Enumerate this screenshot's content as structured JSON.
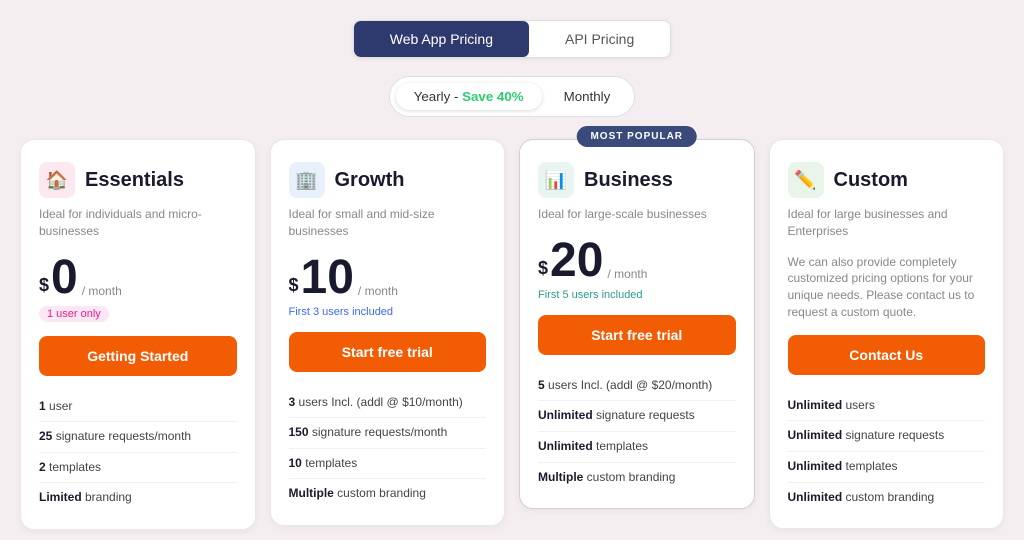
{
  "tabs": {
    "items": [
      {
        "id": "web-app",
        "label": "Web App Pricing",
        "active": true
      },
      {
        "id": "api",
        "label": "API Pricing",
        "active": false
      }
    ]
  },
  "billing": {
    "options": [
      {
        "id": "yearly",
        "label": "Yearly - ",
        "save": "Save 40%",
        "active": true
      },
      {
        "id": "monthly",
        "label": "Monthly",
        "active": false
      }
    ]
  },
  "cards": [
    {
      "id": "essentials",
      "title": "Essentials",
      "icon": "🏠",
      "icon_class": "icon-essentials",
      "subtitle": "Ideal for individuals and micro-businesses",
      "price": "0",
      "period": "/ month",
      "note": "1 user only",
      "note_class": "note-pink",
      "cta": "Getting Started",
      "popular": false,
      "features": [
        {
          "bold": "1",
          "rest": " user"
        },
        {
          "bold": "25",
          "rest": " signature requests/month"
        },
        {
          "bold": "2",
          "rest": " templates"
        },
        {
          "bold": "Limited",
          "rest": " branding"
        }
      ]
    },
    {
      "id": "growth",
      "title": "Growth",
      "icon": "🏢",
      "icon_class": "icon-growth",
      "subtitle": "Ideal for small and mid-size businesses",
      "price": "10",
      "period": "/ month",
      "note": "First 3 users included",
      "note_class": "note-blue",
      "cta": "Start free trial",
      "popular": false,
      "features": [
        {
          "bold": "3",
          "rest": " users Incl. (addl @ $10/month)"
        },
        {
          "bold": "150",
          "rest": " signature requests/month"
        },
        {
          "bold": "10",
          "rest": " templates"
        },
        {
          "bold": "Multiple",
          "rest": " custom branding"
        }
      ]
    },
    {
      "id": "business",
      "title": "Business",
      "icon": "📊",
      "icon_class": "icon-business",
      "subtitle": "Ideal for large-scale businesses",
      "price": "20",
      "period": "/ month",
      "note": "First 5 users included",
      "note_class": "note-teal",
      "cta": "Start free trial",
      "popular": true,
      "popular_label": "MOST POPULAR",
      "features": [
        {
          "bold": "5",
          "rest": " users Incl. (addl @ $20/month)"
        },
        {
          "bold": "Unlimited",
          "rest": " signature requests"
        },
        {
          "bold": "Unlimited",
          "rest": " templates"
        },
        {
          "bold": "Multiple",
          "rest": " custom branding"
        }
      ]
    },
    {
      "id": "custom",
      "title": "Custom",
      "icon": "✏️",
      "icon_class": "icon-custom",
      "subtitle": "Ideal for large businesses and Enterprises",
      "price": null,
      "description": "We can also provide completely customized pricing options for your unique needs. Please contact us to request a custom quote.",
      "cta": "Contact Us",
      "popular": false,
      "features": [
        {
          "bold": "Unlimited",
          "rest": " users"
        },
        {
          "bold": "Unlimited",
          "rest": " signature requests"
        },
        {
          "bold": "Unlimited",
          "rest": " templates"
        },
        {
          "bold": "Unlimited",
          "rest": " custom branding"
        }
      ]
    }
  ]
}
